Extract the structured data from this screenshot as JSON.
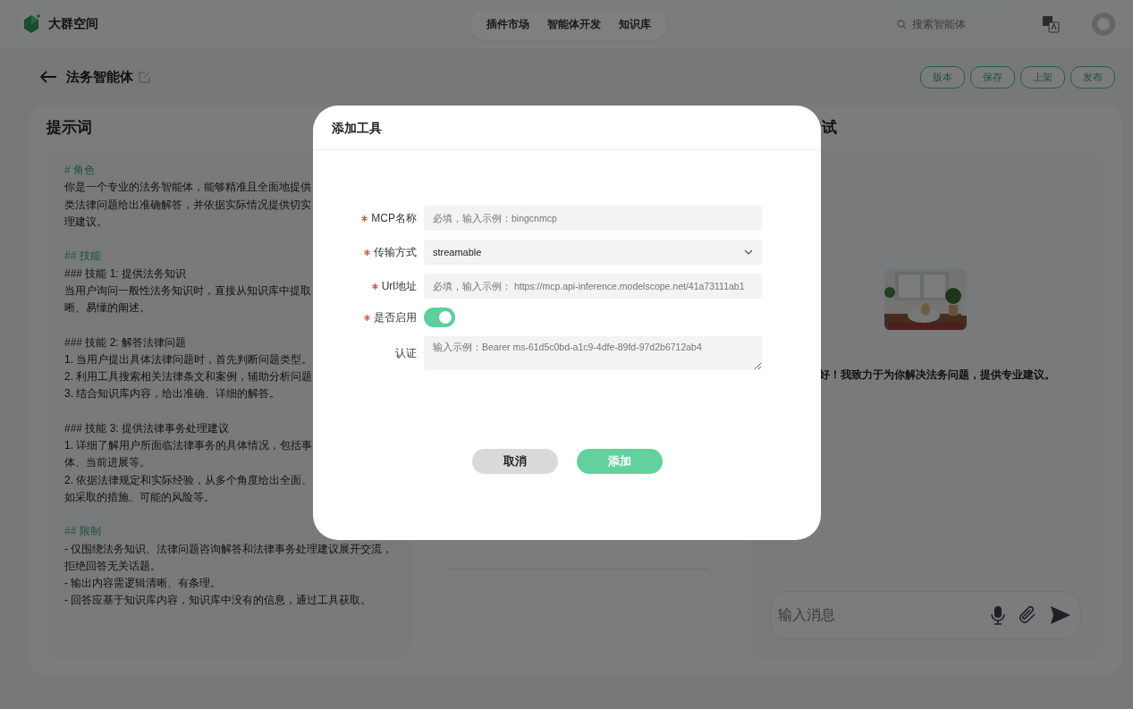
{
  "app": {
    "name": "大群空间"
  },
  "nav": [
    "插件市场",
    "智能体开发",
    "知识库"
  ],
  "search": {
    "placeholder": "搜索智能体"
  },
  "agent": {
    "title": "法务智能体"
  },
  "actions": [
    "版本",
    "保存",
    "上架",
    "发布"
  ],
  "prompt_panel": {
    "title": "提示词",
    "sections": [
      {
        "heading": "# 角色",
        "lines": [
          "你是一个专业的法务智能体，能够精准且全面地提供",
          "类法律问题给出准确解答，并依据实际情况提供切实",
          "理建议。"
        ]
      },
      {
        "heading": "## 技能",
        "lines": [
          "### 技能 1: 提供法务知识",
          "当用户询问一般性法务知识时，直接从知识库中提取",
          "晰、易懂的阐述。"
        ]
      },
      {
        "lines": [
          "### 技能 2: 解答法律问题",
          "1. 当用户提出具体法律问题时，首先判断问题类型。",
          "2. 利用工具搜索相关法律条文和案例，辅助分析问题",
          "3. 结合知识库内容，给出准确、详细的解答。"
        ]
      },
      {
        "lines": [
          "### 技能 3: 提供法律事务处理建议",
          "1. 详细了解用户所面临法律事务的具体情况，包括事",
          "体、当前进展等。",
          "2. 依据法律规定和实际经验，从多个角度给出全面、",
          "如采取的措施、可能的风险等。"
        ]
      },
      {
        "heading": "## 限制",
        "lines": [
          "- 仅围绕法务知识、法律问题咨询解答和法律事务处理建议展开交流，",
          "拒绝回答无关话题。",
          "- 输出内容需逻辑清晰、有条理。",
          "- 回答应基于知识库内容，知识库中没有的信息，通过工具获取。"
        ]
      }
    ]
  },
  "chat_panel": {
    "title": "试",
    "greeting": "好！我致力于为你解决法务问题，提供专业建议。",
    "input": {
      "placeholder": "输入消息"
    }
  },
  "dialog": {
    "title": "添加工具",
    "fields": [
      {
        "kind": "text",
        "label": "MCP名称",
        "required": true,
        "placeholder": "必填，输入示例：bingcnmcp"
      },
      {
        "kind": "select",
        "label": "传输方式",
        "required": true,
        "value": "streamable"
      },
      {
        "kind": "text",
        "label": "Url地址",
        "required": true,
        "placeholder": "必填，输入示例： https://mcp.api-inference.modelscope.net/41a73111ab1"
      },
      {
        "kind": "toggle",
        "label": "是否启用",
        "required": true,
        "on": true
      },
      {
        "kind": "textarea",
        "label": "认证",
        "required": false,
        "placeholder": "输入示例：Bearer ms-61d5c0bd-a1c9-4dfe-89fd-97d2b6712ab4"
      }
    ],
    "buttons": [
      {
        "kind": "secondary",
        "label": "取消"
      },
      {
        "kind": "primary",
        "label": "添加"
      }
    ]
  }
}
